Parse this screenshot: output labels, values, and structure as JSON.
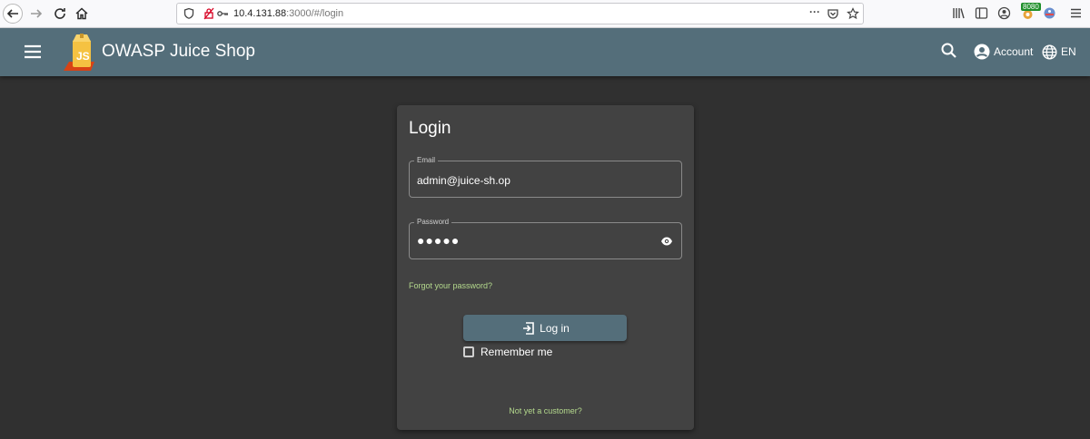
{
  "browser": {
    "url_host": "10.4.131.88",
    "url_path": ":3000/#/login",
    "more_icon": "···",
    "proxy_badge": "8080"
  },
  "app": {
    "title": "OWASP Juice Shop",
    "account_label": "Account",
    "language_label": "EN"
  },
  "login": {
    "title": "Login",
    "email_label": "Email",
    "email_value": "admin@juice-sh.op",
    "password_label": "Password",
    "password_mask": "●●●●●",
    "forgot_link": "Forgot your password?",
    "login_button": "Log in",
    "remember_label": "Remember me",
    "not_customer_link": "Not yet a customer?"
  },
  "colors": {
    "toolbar": "#546e7a",
    "background": "#303030",
    "card": "#424242",
    "link": "#b4d98d"
  }
}
